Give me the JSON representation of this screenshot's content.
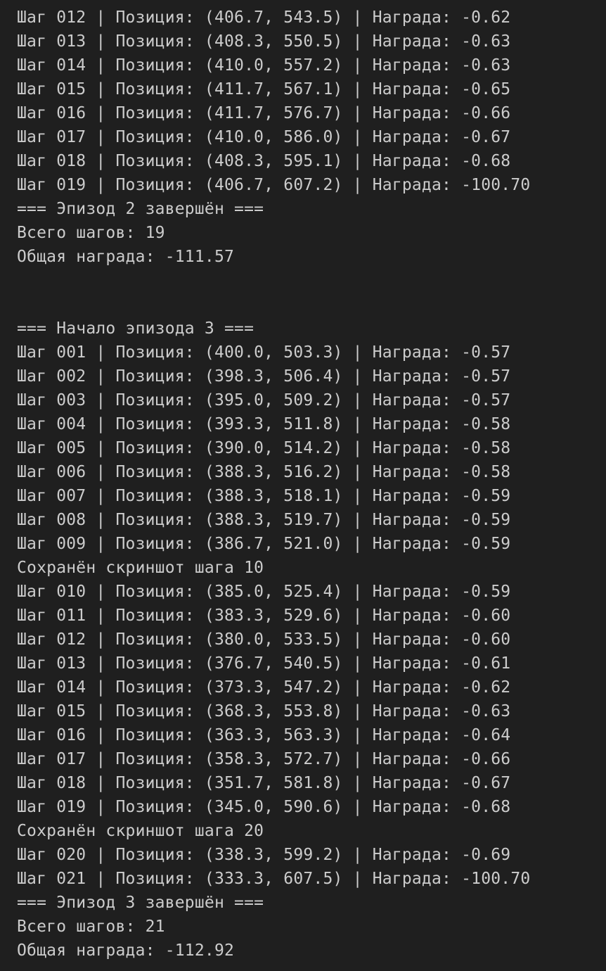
{
  "terminal": {
    "lines": [
      "Шаг 012 | Позиция: (406.7, 543.5) | Награда: -0.62",
      "Шаг 013 | Позиция: (408.3, 550.5) | Награда: -0.63",
      "Шаг 014 | Позиция: (410.0, 557.2) | Награда: -0.63",
      "Шаг 015 | Позиция: (411.7, 567.1) | Награда: -0.65",
      "Шаг 016 | Позиция: (411.7, 576.7) | Награда: -0.66",
      "Шаг 017 | Позиция: (410.0, 586.0) | Награда: -0.67",
      "Шаг 018 | Позиция: (408.3, 595.1) | Награда: -0.68",
      "Шаг 019 | Позиция: (406.7, 607.2) | Награда: -100.70",
      "=== Эпизод 2 завершён ===",
      "Всего шагов: 19",
      "Общая награда: -111.57",
      "",
      "",
      "=== Начало эпизода 3 ===",
      "Шаг 001 | Позиция: (400.0, 503.3) | Награда: -0.57",
      "Шаг 002 | Позиция: (398.3, 506.4) | Награда: -0.57",
      "Шаг 003 | Позиция: (395.0, 509.2) | Награда: -0.57",
      "Шаг 004 | Позиция: (393.3, 511.8) | Награда: -0.58",
      "Шаг 005 | Позиция: (390.0, 514.2) | Награда: -0.58",
      "Шаг 006 | Позиция: (388.3, 516.2) | Награда: -0.58",
      "Шаг 007 | Позиция: (388.3, 518.1) | Награда: -0.59",
      "Шаг 008 | Позиция: (388.3, 519.7) | Награда: -0.59",
      "Шаг 009 | Позиция: (386.7, 521.0) | Награда: -0.59",
      "Сохранён скриншот шага 10",
      "Шаг 010 | Позиция: (385.0, 525.4) | Награда: -0.59",
      "Шаг 011 | Позиция: (383.3, 529.6) | Награда: -0.60",
      "Шаг 012 | Позиция: (380.0, 533.5) | Награда: -0.60",
      "Шаг 013 | Позиция: (376.7, 540.5) | Награда: -0.61",
      "Шаг 014 | Позиция: (373.3, 547.2) | Награда: -0.62",
      "Шаг 015 | Позиция: (368.3, 553.8) | Награда: -0.63",
      "Шаг 016 | Позиция: (363.3, 563.3) | Награда: -0.64",
      "Шаг 017 | Позиция: (358.3, 572.7) | Награда: -0.66",
      "Шаг 018 | Позиция: (351.7, 581.8) | Награда: -0.67",
      "Шаг 019 | Позиция: (345.0, 590.6) | Награда: -0.68",
      "Сохранён скриншот шага 20",
      "Шаг 020 | Позиция: (338.3, 599.2) | Награда: -0.69",
      "Шаг 021 | Позиция: (333.3, 607.5) | Награда: -100.70",
      "=== Эпизод 3 завершён ===",
      "Всего шагов: 21",
      "Общая награда: -112.92"
    ]
  },
  "colors": {
    "background": "#1f1f1f",
    "text": "#cccccc"
  }
}
